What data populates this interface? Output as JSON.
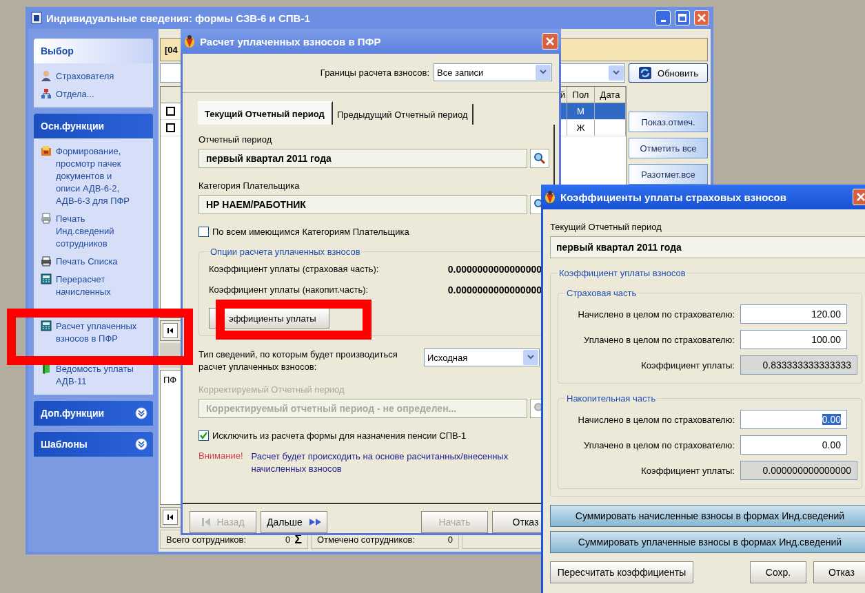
{
  "main_window": {
    "title": "Индивидуальные сведения: формы СЗВ-6 и СПВ-1",
    "sidebar": [
      {
        "title": "Выбор",
        "special": false,
        "expanded": true,
        "items": [
          "Страхователя",
          "Отдела..."
        ]
      },
      {
        "title": "Осн.функции",
        "special": true,
        "expanded": true,
        "items": [
          "Формирование,\nпросмотр пачек\nдокументов и\nописи АДВ-6-2,\nАДВ-6-3 для ПФР",
          "Печать\nИнд.сведений\nсотрудников",
          "Печать Списка",
          "Перерасчет\nначисленных",
          "Расчет уплаченных\nвзносов в ПФР",
          "Ведомость уплаты\nАДВ-11"
        ]
      },
      {
        "title": "Доп.функции",
        "special": true,
        "expanded": false
      },
      {
        "title": "Шаблоны",
        "special": true,
        "expanded": false
      }
    ],
    "info_bar": "[04",
    "refresh_button": "Обновить",
    "table": {
      "columns": [
        "й",
        "Пол",
        "Дата"
      ],
      "rows": [
        {
          "checked": false,
          "selected": true,
          "sex": "М"
        },
        {
          "checked": false,
          "selected": false,
          "sex": "Ж"
        }
      ]
    },
    "side_buttons": [
      "Показ.отмеч.",
      "Отметить все",
      "Разотмет.все"
    ],
    "lower_panel_label": "ПФ",
    "status_bar": [
      {
        "label": "Всего сотрудников:",
        "value": "0",
        "symbol": "Σ"
      },
      {
        "label": "Отмечено сотрудников:",
        "value": "0"
      }
    ]
  },
  "payment_dialog": {
    "title": "Расчет уплаченных взносов в ПФР",
    "bounds_label": "Границы расчета взносов:",
    "bounds_value": "Все записи",
    "tabs": [
      {
        "label": "Текущий Отчетный период",
        "selected": true
      },
      {
        "label": "Предыдущий Отчетный период",
        "selected": false
      }
    ],
    "period_label": "Отчетный период",
    "period_value": "первый квартал 2011 года",
    "category_label": "Категория Плательщика",
    "category_value": "НР НАЕМ/РАБОТНИК",
    "all_categories": {
      "label": "По всем имеющимся Категориям Плательщика",
      "checked": false
    },
    "options_group": {
      "title": "Опции расчета уплаченных взносов",
      "rows": [
        {
          "label": "Коэффициент уплаты (страховая часть):",
          "value": "0.0000000000000000"
        },
        {
          "label": "Коэффициент уплаты (накопит.часть):",
          "value": "0.0000000000000000"
        }
      ],
      "button": "эффициенты уплаты"
    },
    "type_label": "Тип сведений, по которым будет производиться\nрасчет уплаченных взносов:",
    "type_value": "Исходная",
    "corrected_label": "Корректируемый Отчетный период",
    "corrected_value": "Корректируемый отчетный период - не определен...",
    "corrected_disabled": true,
    "exclude": {
      "label": "Исключить из расчета формы для назначения пенсии СПВ-1",
      "checked": true
    },
    "warning_label": "Внимание!",
    "warning_text": "Расчет будет происходить на основе расчитанных/внесенных\nначисленных взносов",
    "buttons": [
      {
        "label": "Назад",
        "kind": "back",
        "disabled": true
      },
      {
        "label": "Дальше",
        "kind": "next",
        "disabled": false
      },
      {
        "label": "Начать",
        "kind": "plain",
        "disabled": true
      },
      {
        "label": "Отказ",
        "kind": "plain",
        "disabled": false
      }
    ]
  },
  "coefficients_dialog": {
    "title": "Коэффициенты уплаты страховых взносов",
    "period_label": "Текущий Отчетный период",
    "period_value": "первый квартал 2011 года",
    "group_title": "Коэффициент уплаты взносов",
    "parts": [
      {
        "title": "Страховая часть",
        "rows": [
          {
            "label": "Начислено в целом по страхователю:",
            "value": "120.00",
            "readonly": false,
            "text_selected": false
          },
          {
            "label": "Уплачено в целом по страхователю:",
            "value": "100.00",
            "readonly": false,
            "text_selected": false
          },
          {
            "label": "Коэффициент уплаты:",
            "value": "0.833333333333333",
            "readonly": true,
            "text_selected": false
          }
        ]
      },
      {
        "title": "Накопительная часть",
        "rows": [
          {
            "label": "Начислено в целом по страхователю:",
            "value": "0.00",
            "readonly": false,
            "text_selected": true
          },
          {
            "label": "Уплачено в целом по страхователю:",
            "value": "0.00",
            "readonly": false,
            "text_selected": false
          },
          {
            "label": "Коэффициент уплаты:",
            "value": "0.000000000000000",
            "readonly": true,
            "text_selected": false
          }
        ]
      }
    ],
    "sum_buttons": [
      "Суммировать начисленные взносы в формах Инд.сведений",
      "Суммировать уплаченные взносы в формах Инд.сведений"
    ],
    "recalc_button": "Пересчитать коэффициенты",
    "save_button": "Сохр.",
    "cancel_button": "Отказ"
  }
}
